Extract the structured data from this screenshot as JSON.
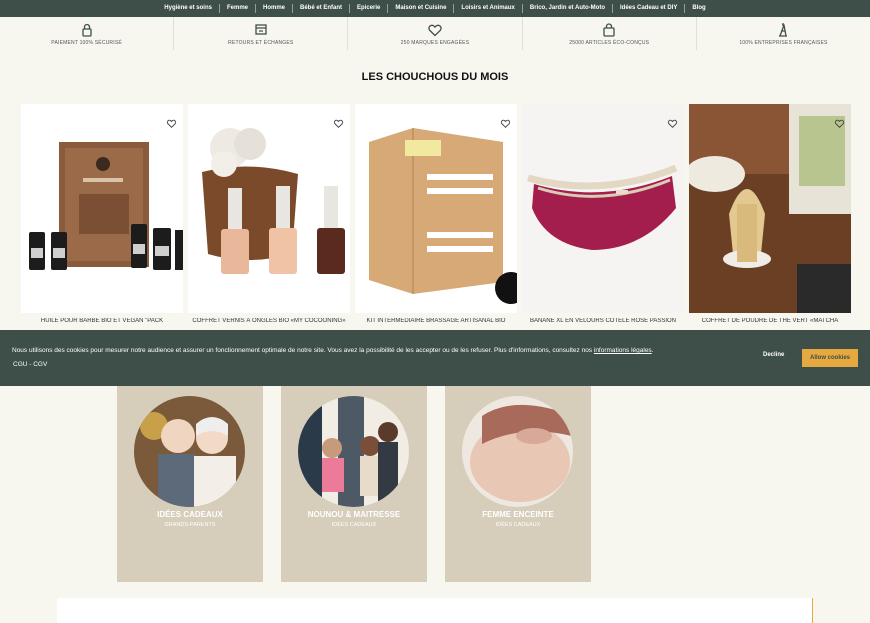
{
  "top_nav": [
    "Hygiène et soins",
    "Femme",
    "Homme",
    "Bébé et Enfant",
    "Epicerie",
    "Maison et Cuisine",
    "Loisirs et Animaux",
    "Brico, Jardin et Auto-Moto",
    "Idées Cadeau et DIY",
    "Blog"
  ],
  "reassurance": [
    {
      "icon": "lock-icon",
      "label": "PAIEMENT 100% SÉCURISÉ"
    },
    {
      "icon": "return-box-icon",
      "label": "RETOURS ET ÉCHANGES"
    },
    {
      "icon": "heart-icon",
      "label": "250 MARQUES ENGAGÉES"
    },
    {
      "icon": "bag-icon",
      "label": "25000 ARTICLES ÉCO-CONÇUS"
    },
    {
      "icon": "eiffel-tower-icon",
      "label": "100% ENTREPRISES FRANÇAISES"
    }
  ],
  "section_title": "LES CHOUCHOUS DU MOIS",
  "products": [
    {
      "name": "HUILE POUR BARBE BIO ET VEGAN \"PACK"
    },
    {
      "name": "COFFRET VERNIS À ONGLES BIO «MY COCOONING»"
    },
    {
      "name": "KIT INTERMÉDIAIRE BRASSAGE ARTISANAL BIO"
    },
    {
      "name": "BANANE XL EN VELOURS CÔTELÉ ROSE PASSION"
    },
    {
      "name": "COFFRET DE POUDRE DE THÉ VERT «MATCHA"
    }
  ],
  "cookie": {
    "message": "Nous utilisons des cookies pour mesurer notre audience et assurer un fonctionnement optimale de notre site. Vous avez la possibilité de les accepter ou de les refuser. Plus d'informations, consultez nos",
    "link": "informations légales",
    "link_suffix": ".",
    "cgu": "CGU - CGV",
    "decline": "Decline",
    "allow": "Allow cookies"
  },
  "ideas": [
    {
      "title": "IDÉES CADEAUX",
      "subtitle": "GRANDS-PARENTS"
    },
    {
      "title": "NOUNOU & MAITRESSE",
      "subtitle": "IDÉES CADEAUX"
    },
    {
      "title": "FEMME ENCEINTE",
      "subtitle": "IDÉES CADEAUX"
    }
  ],
  "colors": {
    "brand_green": "#3d4f48",
    "accent": "#e5a93f",
    "card_beige": "#d6cdbb",
    "page_bg": "#f7f7ef"
  }
}
